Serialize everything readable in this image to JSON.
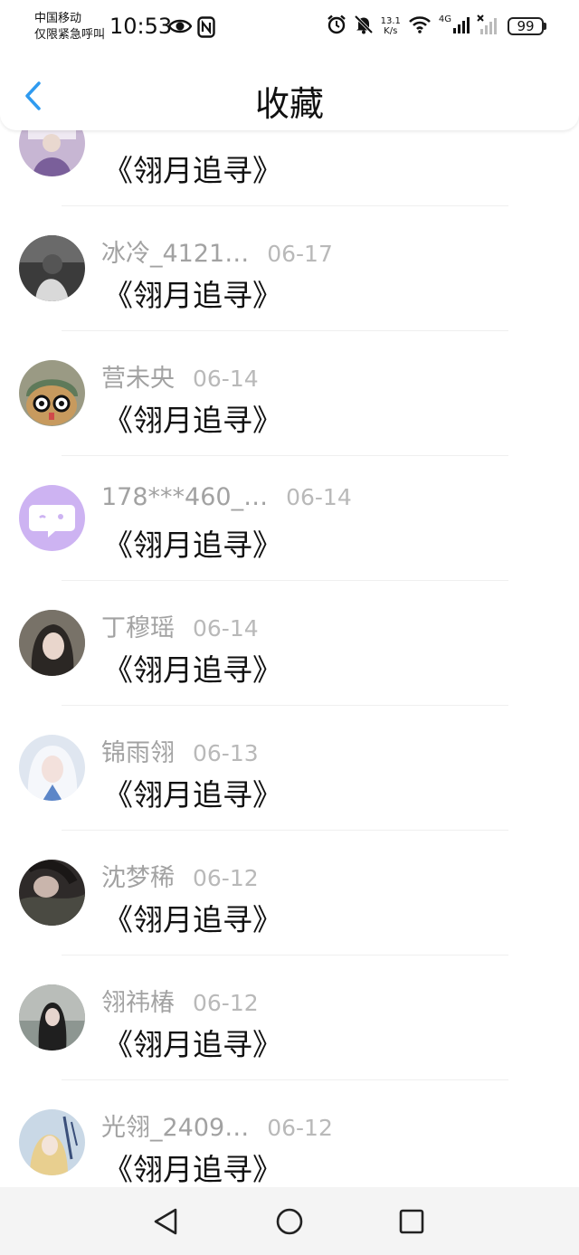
{
  "status_bar": {
    "carrier_line1": "中国移动",
    "carrier_line2": "仅限紧急呼叫",
    "time": "10:53",
    "speed_value": "13.1",
    "speed_unit": "K/s",
    "network": "4G",
    "battery": "99"
  },
  "header": {
    "title": "收藏"
  },
  "items": [
    {
      "name": "",
      "date": "",
      "content": "《翎月追寻》",
      "avatar_color": "#c7b6d3"
    },
    {
      "name": "冰冷_4121…",
      "date": "06-17",
      "content": "《翎月追寻》",
      "avatar_color": "#3b3b3b"
    },
    {
      "name": "营未央",
      "date": "06-14",
      "content": "《翎月追寻》",
      "avatar_color": "#9a9a84"
    },
    {
      "name": "178***460_…",
      "date": "06-14",
      "content": "《翎月追寻》",
      "avatar_color": "#cdb3f2"
    },
    {
      "name": "丁穆瑶",
      "date": "06-14",
      "content": "《翎月追寻》",
      "avatar_color": "#5d5852"
    },
    {
      "name": "锦雨翎",
      "date": "06-13",
      "content": "《翎月追寻》",
      "avatar_color": "#dfe6f0"
    },
    {
      "name": "沈梦稀",
      "date": "06-12",
      "content": "《翎月追寻》",
      "avatar_color": "#2e2a29"
    },
    {
      "name": "翎祎椿",
      "date": "06-12",
      "content": "《翎月追寻》",
      "avatar_color": "#8d9691"
    },
    {
      "name": "光翎_2409…",
      "date": "06-12",
      "content": "《翎月追寻》",
      "avatar_color": "#c9d8e6"
    }
  ],
  "colors": {
    "accent": "#2f9bf0",
    "name_text": "#a2a2a2",
    "date_text": "#b9b9b9"
  }
}
